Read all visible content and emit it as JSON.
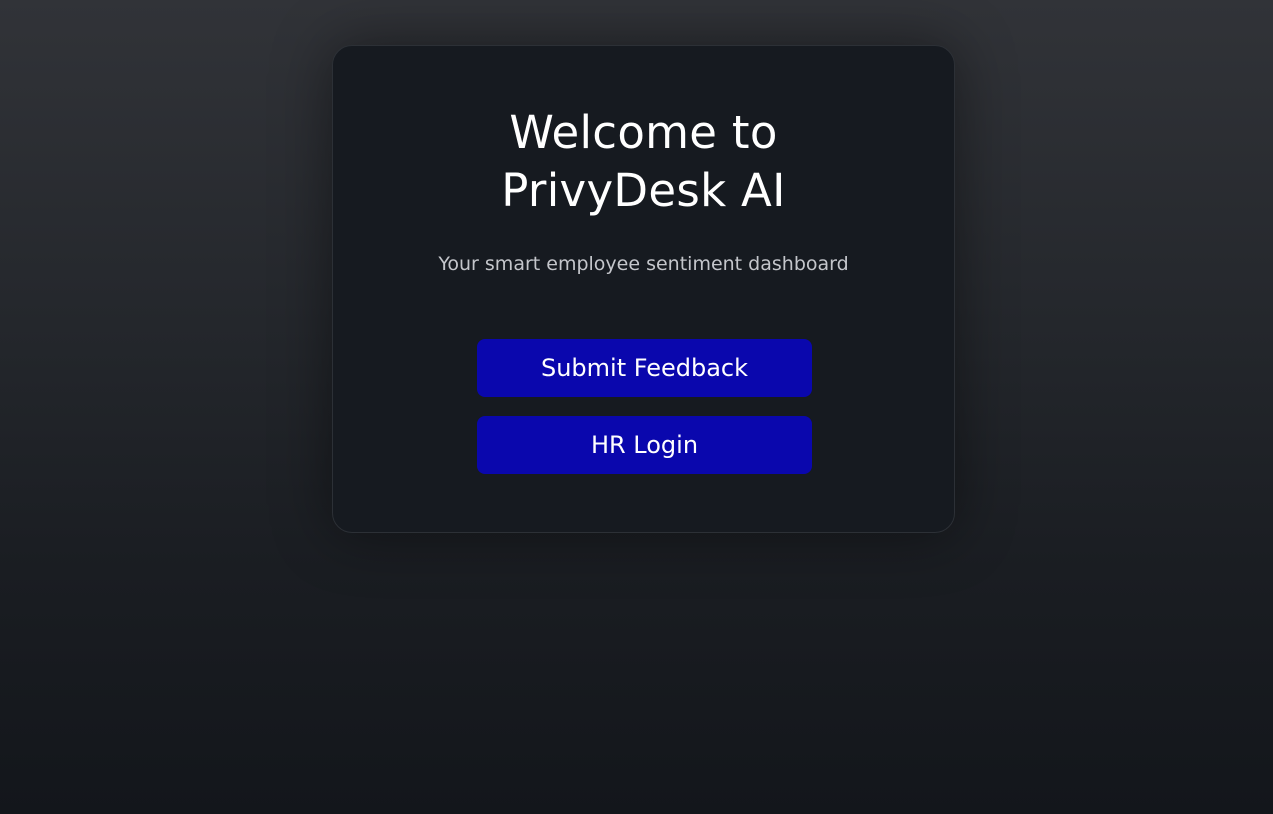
{
  "welcome": {
    "title_line1": "Welcome to",
    "title_line2": "PrivyDesk AI",
    "subtitle": "Your smart employee sentiment dashboard"
  },
  "actions": {
    "submit_feedback_label": "Submit Feedback",
    "hr_login_label": "HR Login"
  },
  "colors": {
    "button_bg": "#0a07ad",
    "card_bg": "#161a20",
    "text_primary": "#ffffff",
    "text_secondary": "#c4c6cb"
  }
}
